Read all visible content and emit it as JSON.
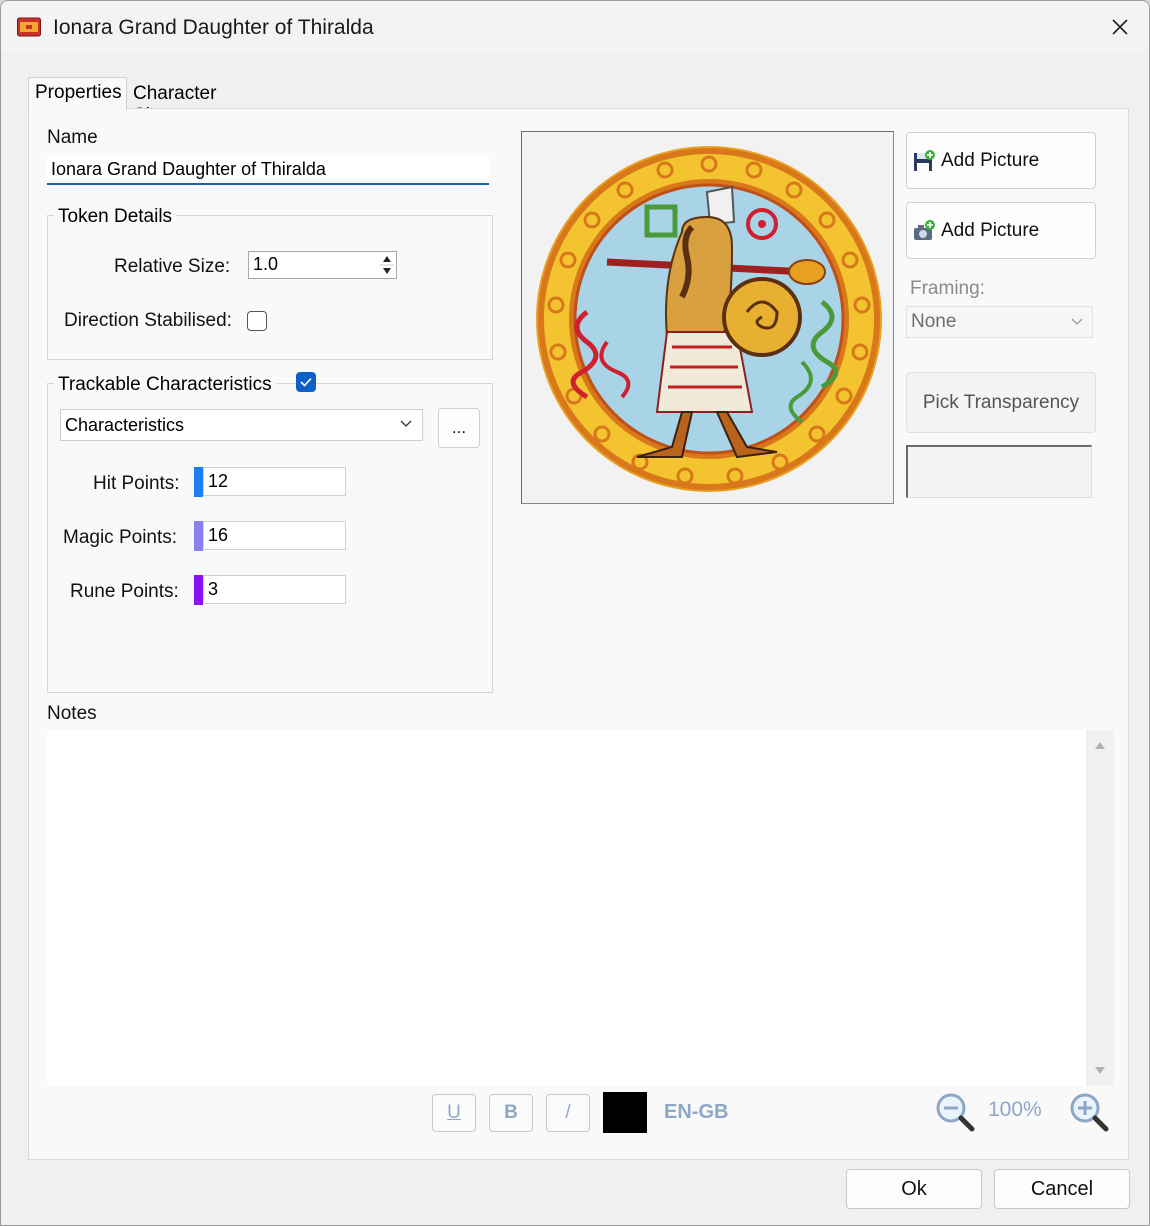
{
  "window": {
    "title": "Ionara Grand Daughter of Thiralda"
  },
  "tabs": [
    {
      "label": "Properties"
    },
    {
      "label": "Character Sheet"
    }
  ],
  "name": {
    "label": "Name",
    "value": "Ionara Grand Daughter of Thiralda"
  },
  "token_details": {
    "caption": "Token Details",
    "relative_size_label": "Relative Size:",
    "relative_size_value": "1.0",
    "direction_label": "Direction Stabilised:",
    "direction_checked": false
  },
  "trackable": {
    "caption": "Trackable Characteristics",
    "enabled": true,
    "dropdown_value": "Characteristics",
    "more_label": "...",
    "rows": [
      {
        "label": "Hit Points:",
        "value": "12",
        "color": "#1a7ff0"
      },
      {
        "label": "Magic Points:",
        "value": "16",
        "color": "#8b7ff0"
      },
      {
        "label": "Rune Points:",
        "value": "3",
        "color": "#8a12f0"
      }
    ]
  },
  "picture": {
    "add_picture_1": "Add Picture",
    "add_picture_2": "Add Picture",
    "framing_label": "Framing:",
    "framing_value": "None",
    "pick_transparency": "Pick Transparency"
  },
  "notes": {
    "label": "Notes",
    "content": ""
  },
  "format_toolbar": {
    "underline": "U",
    "bold": "B",
    "italic": "/",
    "color": "#000000",
    "language": "EN-GB",
    "zoom": "100%"
  },
  "footer": {
    "ok": "Ok",
    "cancel": "Cancel"
  }
}
